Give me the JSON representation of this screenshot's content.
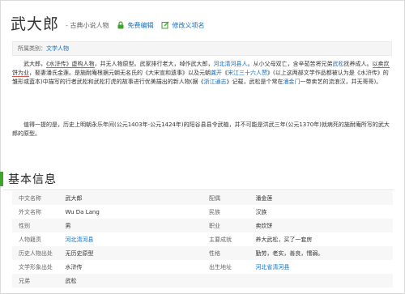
{
  "header": {
    "title": "武大郎",
    "subtitle": "- 古典小说人物",
    "actions": [
      {
        "label": "免费编辑",
        "icon": "lock-icon"
      },
      {
        "label": "修改义项名",
        "icon": "edit-icon"
      }
    ]
  },
  "tags": {
    "label": "所属类别：",
    "value": "文学人物"
  },
  "intro": {
    "p1": [
      {
        "t": "武大郎，"
      },
      {
        "t": "《水浒传》虚构人物",
        "u": true
      },
      {
        "t": "，并无人物原型。武家排行老大，绰作武大郎，"
      },
      {
        "t": "河北清河县人",
        "link": true
      },
      {
        "t": "。从小父母双亡，含辛茹苦将兄弟"
      },
      {
        "t": "武松",
        "link": true
      },
      {
        "t": "抚养成人。"
      },
      {
        "t": "以卖炊饼为业",
        "u": true
      },
      {
        "t": "，娶妻潘氏金莲。是施耐庵根据元朝无名氏的《大宋宣和遗事》以及元朝"
      },
      {
        "t": "龚开",
        "link": true
      },
      {
        "t": "《"
      },
      {
        "t": "宋江三十六人赞",
        "link": true
      },
      {
        "t": "》(以上这两部文学作品都被认为是《水浒传》的雏形或蓝本)中描写的行者武松和武松打虎的故事进行优美描出的新人物(据《"
      },
      {
        "t": "浙江通志",
        "link": true
      },
      {
        "t": "》记载，武松是个常在"
      },
      {
        "t": "涌金门",
        "link": true
      },
      {
        "t": "一带卖艺的流浪汉，并无哥哥)。"
      }
    ],
    "p2": "值得一提的是，历史上明朝永乐年间(公元1403年-公元1424年)的阳谷县县令武植，并不可能是洪武三年(公元1370年)就病死的施耐庵所写的武大郎的原型。"
  },
  "section": {
    "title": "基本信息"
  },
  "info": {
    "rows": [
      [
        {
          "k": "中文名称",
          "v": "武大郎"
        },
        {
          "k": "配偶",
          "v": "潘金莲"
        }
      ],
      [
        {
          "k": "外文名称",
          "v": "Wu Da Lang"
        },
        {
          "k": "民族",
          "v": "汉族"
        }
      ],
      [
        {
          "k": "性别",
          "v": "男"
        },
        {
          "k": "职业",
          "v": "卖炊饼"
        }
      ],
      [
        {
          "k": "人物籍贯",
          "v": "河北清河县",
          "link": true
        },
        {
          "k": "主要成就",
          "v": "养大武松，买了一套房"
        }
      ],
      [
        {
          "k": "历史人物出处",
          "v": "无历史原型"
        },
        {
          "k": "性格",
          "v": "勤劳，老实，善良，懦弱。"
        }
      ],
      [
        {
          "k": "文学形象出处",
          "v": "水浒传"
        },
        {
          "k": "出生地址",
          "v": "河北省清河县",
          "link": true
        }
      ],
      [
        {
          "k": "兄弟",
          "v": "武松"
        },
        {
          "k": "",
          "v": ""
        }
      ]
    ]
  },
  "colors": {
    "link": "#136ec2",
    "accent": "#3ea32b",
    "underline": "#d9534f"
  }
}
